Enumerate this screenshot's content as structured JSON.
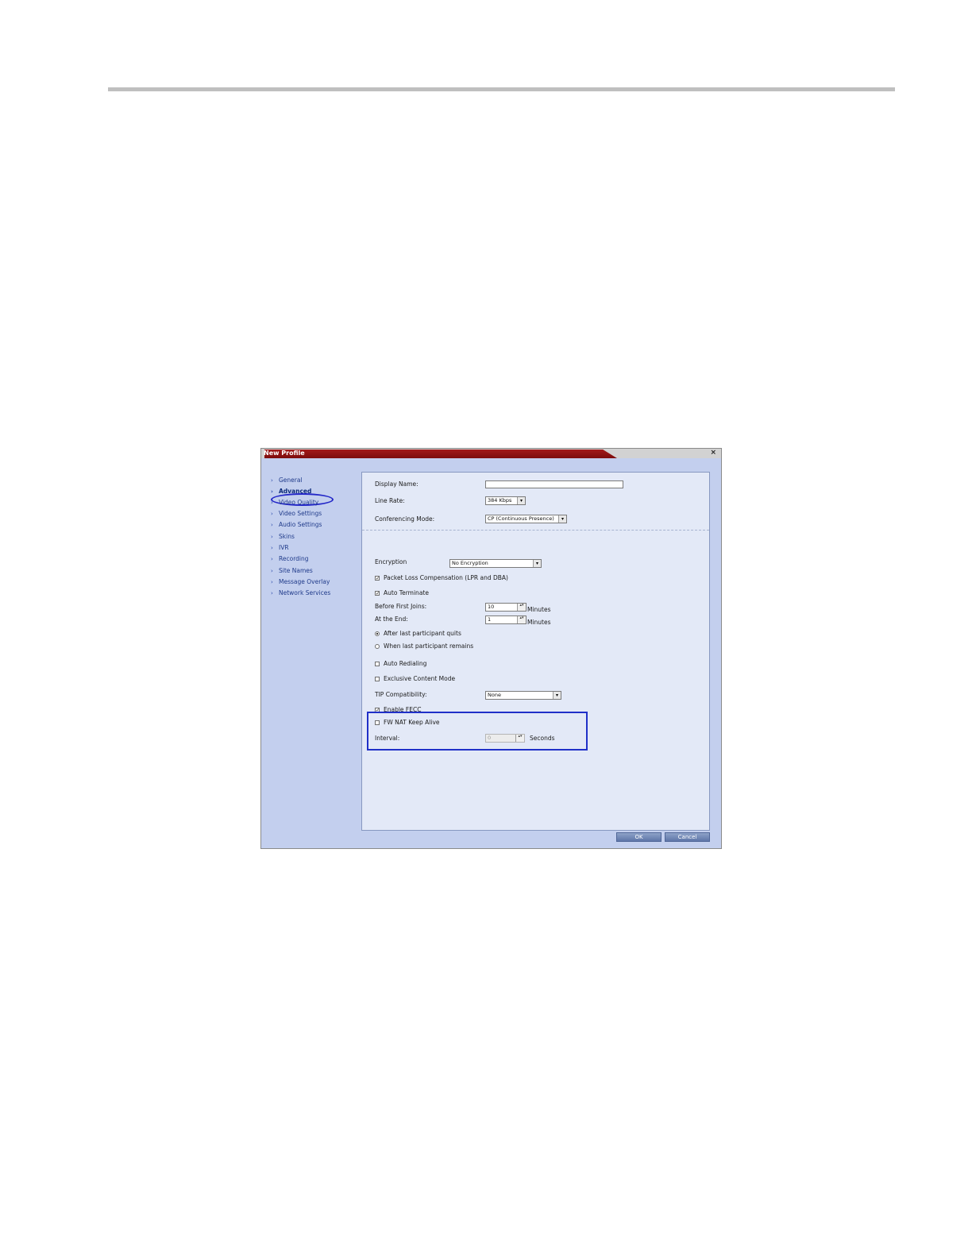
{
  "window": {
    "title": "New Profile",
    "close_glyph": "×"
  },
  "nav": {
    "items": [
      {
        "label": "General"
      },
      {
        "label": "Advanced",
        "active": true
      },
      {
        "label": "Video Quality"
      },
      {
        "label": "Video Settings"
      },
      {
        "label": "Audio Settings"
      },
      {
        "label": "Skins"
      },
      {
        "label": "IVR"
      },
      {
        "label": "Recording"
      },
      {
        "label": "Site Names"
      },
      {
        "label": "Message Overlay"
      },
      {
        "label": "Network Services"
      }
    ],
    "arrow_glyph": "›"
  },
  "form": {
    "display_name": {
      "label": "Display Name:",
      "value": ""
    },
    "line_rate": {
      "label": "Line Rate:",
      "value": "384 Kbps"
    },
    "conferencing_mode": {
      "label": "Conferencing Mode:",
      "value": "CP (Continuous Presence)"
    },
    "encryption": {
      "label": "Encryption",
      "value": "No Encryption"
    },
    "packet_loss": {
      "label": "Packet Loss Compensation (LPR and DBA)",
      "checked": true
    },
    "auto_terminate": {
      "label": "Auto Terminate",
      "checked": true
    },
    "before_first_joins": {
      "label": "Before First Joins:",
      "value": "10",
      "unit": "Minutes"
    },
    "at_the_end": {
      "label": "At the End:",
      "value": "1",
      "unit": "Minutes"
    },
    "after_last_quits": {
      "label": "After last participant quits",
      "selected": true
    },
    "when_last_remains": {
      "label": "When last participant remains",
      "selected": false
    },
    "auto_redialing": {
      "label": "Auto Redialing",
      "checked": false
    },
    "exclusive_content": {
      "label": "Exclusive Content Mode",
      "checked": false
    },
    "tip_compatibility": {
      "label": "TIP Compatibility:",
      "value": "None"
    },
    "enable_fecc": {
      "label": "Enable FECC",
      "checked": true
    },
    "fw_nat_keep_alive": {
      "label": "FW NAT Keep Alive",
      "checked": false
    },
    "interval": {
      "label": "Interval:",
      "value": "0",
      "unit": "Seconds"
    }
  },
  "buttons": {
    "ok": "OK",
    "cancel": "Cancel"
  },
  "glyphs": {
    "check": "✓",
    "dropdown": "▾",
    "spin": "▴▾"
  },
  "colors": {
    "title_bar": "#8e1212",
    "highlight": "#2030c8",
    "nav_bg": "#c3cfee",
    "panel_bg": "#e3e9f7"
  }
}
